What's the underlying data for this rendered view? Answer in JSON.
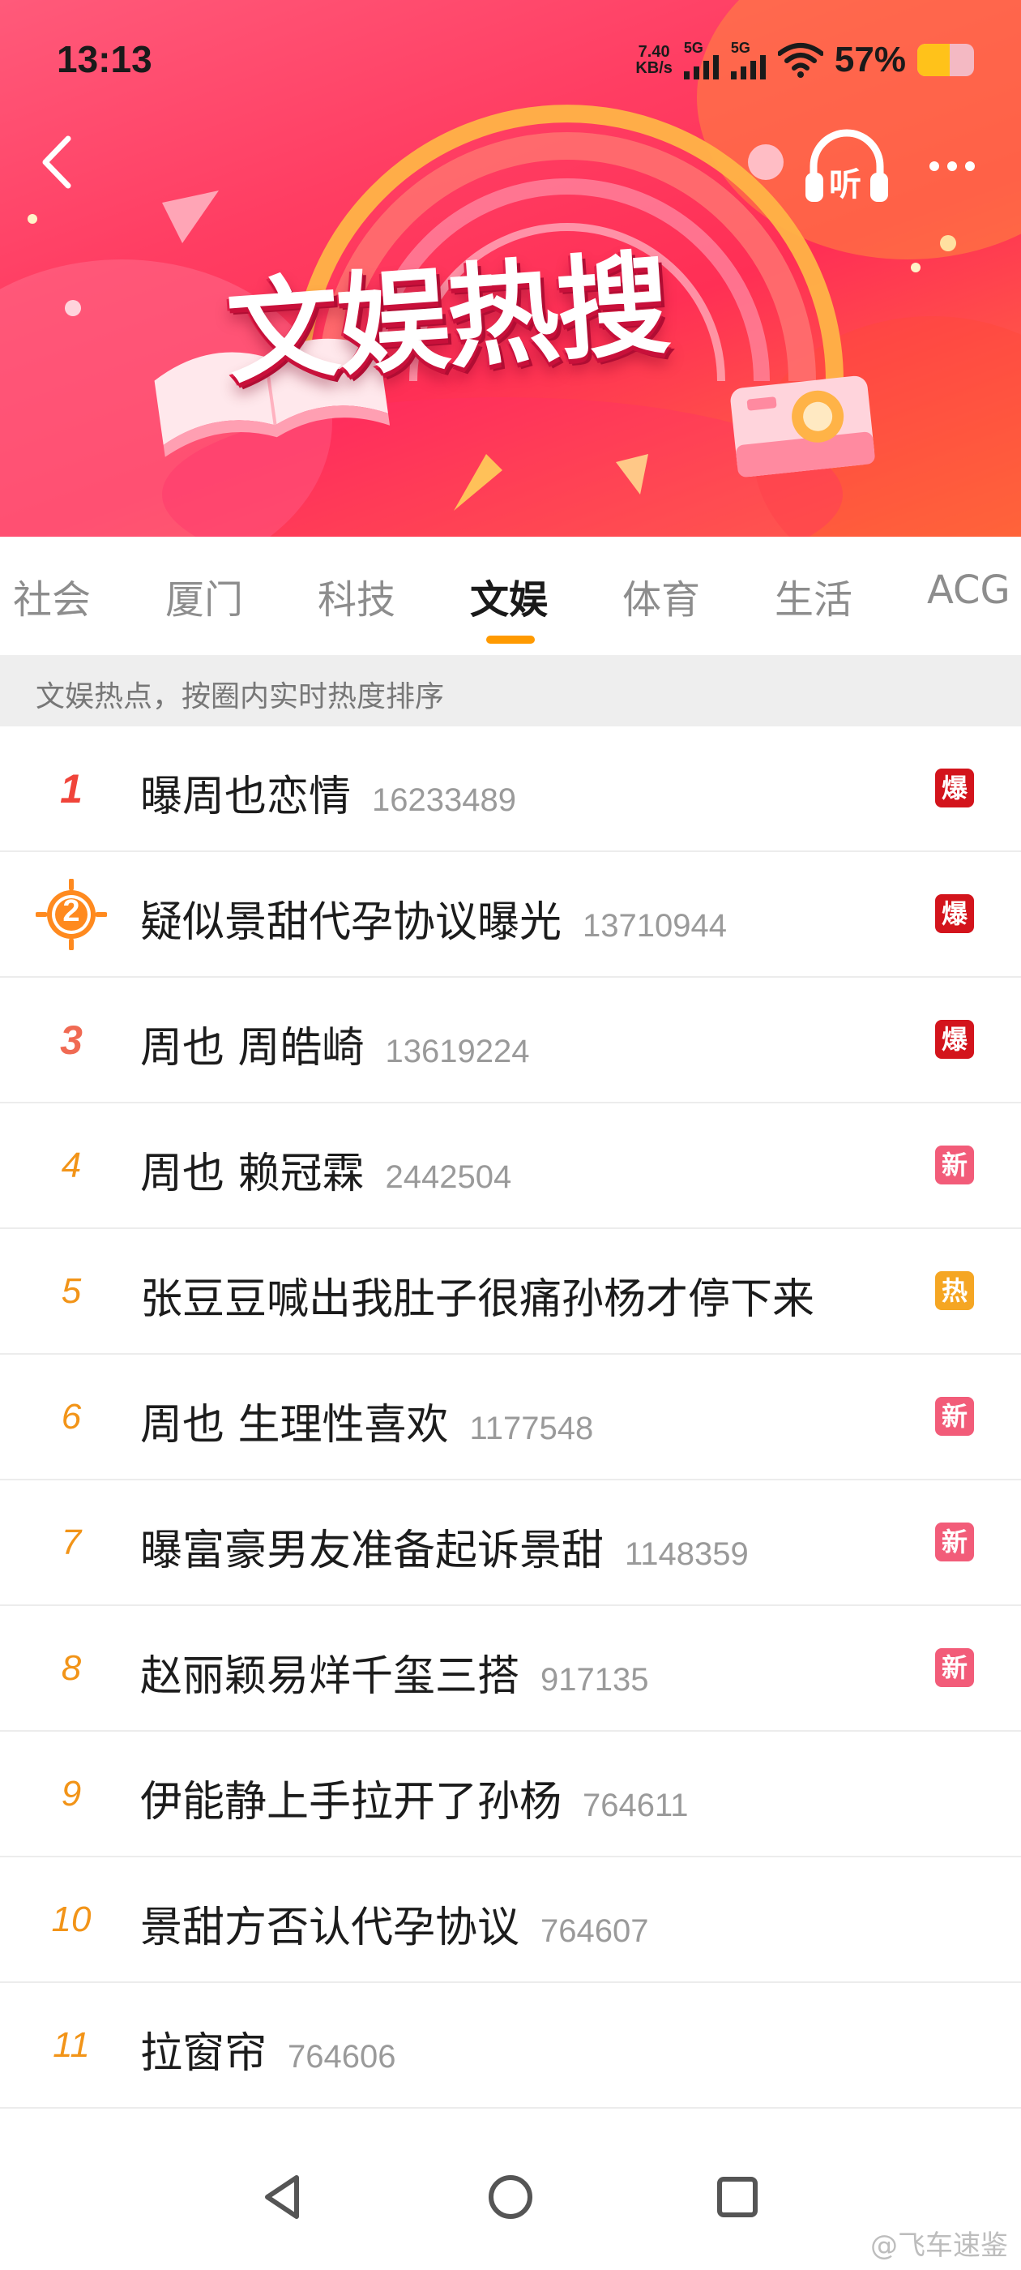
{
  "status_bar": {
    "time": "13:13",
    "net_speed_value": "7.40",
    "net_speed_unit": "KB/s",
    "signal_1_label": "5G",
    "signal_2_label": "5G",
    "battery_percent": "57%",
    "battery_level": 0.57
  },
  "header": {
    "title": "文娱热搜",
    "listen_label": "听"
  },
  "tabs": [
    {
      "label": "社会"
    },
    {
      "label": "厦门"
    },
    {
      "label": "科技"
    },
    {
      "label": "文娱"
    },
    {
      "label": "体育"
    },
    {
      "label": "生活"
    },
    {
      "label": "ACG"
    }
  ],
  "active_tab": "文娱",
  "subtitle": "文娱热点，按圈内实时热度排序",
  "items": [
    {
      "rank": "1",
      "title": "曝周也恋情",
      "count": "16233489",
      "badge": "爆"
    },
    {
      "rank": "2",
      "title": "疑似景甜代孕协议曝光",
      "count": "13710944",
      "badge": "爆"
    },
    {
      "rank": "3",
      "title": "周也 周皓崎",
      "count": "13619224",
      "badge": "爆"
    },
    {
      "rank": "4",
      "title": "周也 赖冠霖",
      "count": "2442504",
      "badge": "新"
    },
    {
      "rank": "5",
      "title": "张豆豆喊出我肚子很痛孙杨才停下来",
      "count": "",
      "badge": "热"
    },
    {
      "rank": "6",
      "title": "周也 生理性喜欢",
      "count": "1177548",
      "badge": "新"
    },
    {
      "rank": "7",
      "title": "曝富豪男友准备起诉景甜",
      "count": "1148359",
      "badge": "新"
    },
    {
      "rank": "8",
      "title": "赵丽颖易烊千玺三搭",
      "count": "917135",
      "badge": "新"
    },
    {
      "rank": "9",
      "title": "伊能静上手拉开了孙杨",
      "count": "764611",
      "badge": ""
    },
    {
      "rank": "10",
      "title": "景甜方否认代孕协议",
      "count": "764607",
      "badge": ""
    },
    {
      "rank": "11",
      "title": "拉窗帘",
      "count": "764606",
      "badge": ""
    }
  ],
  "badge_colors": {
    "爆": "#d3141c",
    "新": "#f25c79",
    "热": "#f5a623"
  },
  "watermark": "@飞车速鉴"
}
